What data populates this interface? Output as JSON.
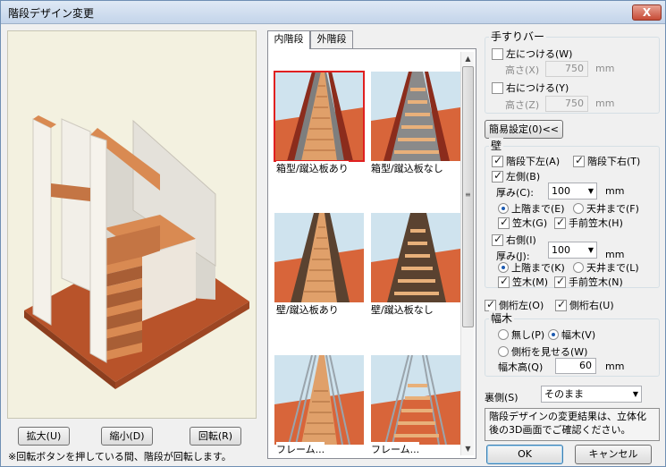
{
  "window": {
    "title": "階段デザイン変更",
    "close_label": "X"
  },
  "preview": {
    "zoom_in_label": "拡大(U)",
    "zoom_out_label": "縮小(D)",
    "rotate_label": "回転(R)",
    "note": "※回転ボタンを押している間、階段が回転します。"
  },
  "tabs": [
    {
      "label": "内階段",
      "active": true
    },
    {
      "label": "外階段",
      "active": false
    }
  ],
  "gallery": [
    {
      "caption": "箱型/蹴込板あり",
      "style": "box-riser",
      "selected": true
    },
    {
      "caption": "箱型/蹴込板なし",
      "style": "box-open",
      "selected": false
    },
    {
      "caption": "壁/蹴込板あり",
      "style": "wall-riser",
      "selected": false
    },
    {
      "caption": "壁/蹴込板なし",
      "style": "wall-open",
      "selected": false
    },
    {
      "caption": "フレーム...",
      "style": "frame",
      "selected": false
    },
    {
      "caption": "フレーム...",
      "style": "frame-open",
      "selected": false
    }
  ],
  "handrail": {
    "title": "手すりバー",
    "left_label": "左につける(W)",
    "left_checked": false,
    "left_height_label": "高さ(X)",
    "left_height": "750",
    "right_label": "右につける(Y)",
    "right_checked": false,
    "right_height_label": "高さ(Z)",
    "right_height": "750",
    "unit": "mm"
  },
  "simple_settings_label": "簡易設定(0)<<",
  "wall": {
    "title": "壁",
    "under_left_label": "階段下左(A)",
    "under_left": true,
    "under_right_label": "階段下右(T)",
    "under_right": true,
    "left": {
      "label": "左側(B)",
      "checked": true,
      "thickness_label": "厚み(C):",
      "thickness": "100",
      "unit": "mm",
      "to_upper_label": "上階まで(E)",
      "to_ceiling_label": "天井まで(F)",
      "selected": "upper",
      "kasagi_label": "笠木(G)",
      "kasagi": true,
      "front_kasagi_label": "手前笠木(H)",
      "front_kasagi": true
    },
    "right": {
      "label": "右側(I)",
      "checked": true,
      "thickness_label": "厚み(J):",
      "thickness": "100",
      "unit": "mm",
      "to_upper_label": "上階まで(K)",
      "to_ceiling_label": "天井まで(L)",
      "selected": "upper",
      "kasagi_label": "笠木(M)",
      "kasagi": true,
      "front_kasagi_label": "手前笠木(N)",
      "front_kasagi": true
    }
  },
  "stringer_left_label": "側桁左(O)",
  "stringer_left": true,
  "stringer_right_label": "側桁右(U)",
  "stringer_right": true,
  "baseboard": {
    "title": "幅木",
    "none_label": "無し(P)",
    "baseboard_label": "幅木(V)",
    "show_stringer_label": "側桁を見せる(W)",
    "selected": "baseboard",
    "height_label": "幅木高(Q)",
    "height": "60",
    "unit": "mm"
  },
  "back_side": {
    "label": "裏側(S)",
    "value": "そのまま"
  },
  "message": "階段デザインの変更結果は、立体化後の3D画面でご確認ください。",
  "ok_label": "OK",
  "cancel_label": "キャンセル",
  "colors": {
    "floor": "#b8532a",
    "stair_wood": "#d98a52",
    "wall": "#eeebe4",
    "selection": "#e02020"
  }
}
